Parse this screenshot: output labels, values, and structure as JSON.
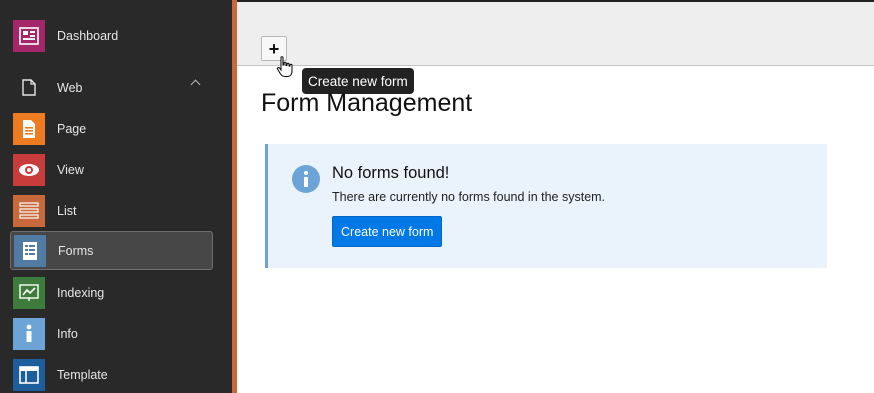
{
  "sidebar": {
    "items": [
      {
        "label": "Dashboard",
        "icon": "dashboard-icon",
        "color": "#a4276a"
      },
      {
        "label": "Web",
        "icon": "page-outline-icon",
        "color": "#292929"
      },
      {
        "label": "Page",
        "icon": "page-icon",
        "color": "#ed7b22"
      },
      {
        "label": "View",
        "icon": "eye-icon",
        "color": "#c83c3c"
      },
      {
        "label": "List",
        "icon": "list-icon",
        "color": "#c8693b"
      },
      {
        "label": "Forms",
        "icon": "forms-icon",
        "color": "#527ba3"
      },
      {
        "label": "Indexing",
        "icon": "chart-icon",
        "color": "#3d7c3b"
      },
      {
        "label": "Info",
        "icon": "info-icon",
        "color": "#6ca4d8"
      },
      {
        "label": "Template",
        "icon": "template-icon",
        "color": "#1c5e9b"
      }
    ]
  },
  "toolbar": {
    "add_button_label": "+",
    "tooltip": "Create new form"
  },
  "main": {
    "title": "Form Management",
    "callout": {
      "title": "No forms found!",
      "text": "There are currently no forms found in the system.",
      "button_label": "Create new form"
    }
  }
}
